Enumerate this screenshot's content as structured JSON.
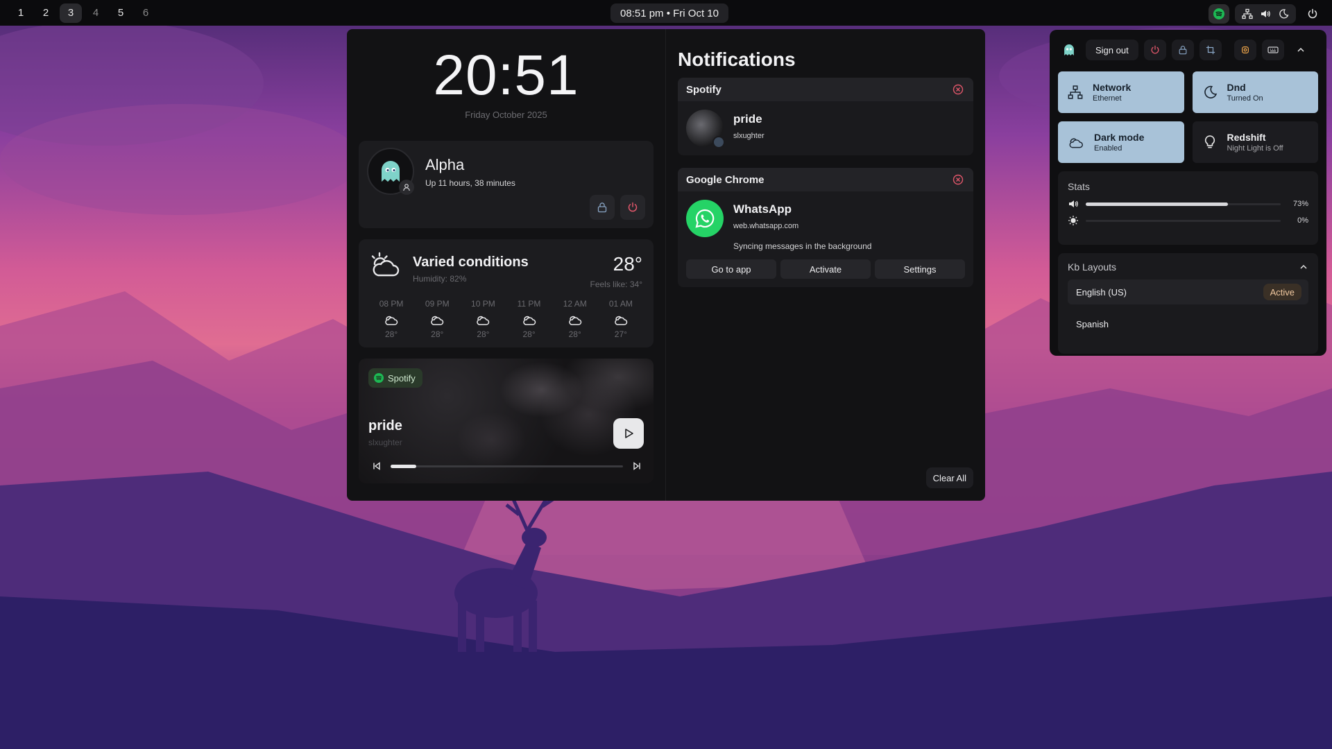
{
  "topbar": {
    "workspaces": [
      "1",
      "2",
      "3",
      "4",
      "5",
      "6"
    ],
    "active_workspace": "3",
    "datetime": "08:51 pm • Fri Oct 10"
  },
  "dashboard": {
    "time": "20:51",
    "date": "Friday October 2025",
    "user": {
      "name": "Alpha",
      "uptime": "Up 11 hours, 38 minutes"
    },
    "weather": {
      "condition": "Varied conditions",
      "humidity": "Humidity: 82%",
      "temperature": "28°",
      "feels_like": "Feels like: 34°",
      "hourly": [
        {
          "time": "08 PM",
          "temp": "28°"
        },
        {
          "time": "09 PM",
          "temp": "28°"
        },
        {
          "time": "10 PM",
          "temp": "28°"
        },
        {
          "time": "11 PM",
          "temp": "28°"
        },
        {
          "time": "12 AM",
          "temp": "28°"
        },
        {
          "time": "01 AM",
          "temp": "27°"
        }
      ]
    },
    "media": {
      "source": "Spotify",
      "title": "pride",
      "artist": "slxughter",
      "progress": 0.11
    }
  },
  "notifications": {
    "header": "Notifications",
    "items": [
      {
        "app": "Spotify",
        "title": "pride",
        "subtitle": "slxughter"
      },
      {
        "app": "Google Chrome",
        "title": "WhatsApp",
        "subtitle": "web.whatsapp.com",
        "message": "Syncing messages in the background",
        "actions": [
          "Go to app",
          "Activate",
          "Settings"
        ]
      }
    ],
    "clear_label": "Clear All"
  },
  "quick_settings": {
    "sign_out": "Sign out",
    "tiles": [
      {
        "label": "Network",
        "status": "Ethernet",
        "on": true,
        "icon": "network-icon"
      },
      {
        "label": "Dnd",
        "status": "Turned On",
        "on": true,
        "icon": "moon-icon"
      },
      {
        "label": "Dark mode",
        "status": "Enabled",
        "on": true,
        "icon": "cloud-moon-icon"
      },
      {
        "label": "Redshift",
        "status": "Night Light is Off",
        "on": false,
        "icon": "bulb-icon"
      }
    ],
    "stats": {
      "title": "Stats",
      "volume": {
        "label": "73%",
        "value": 0.73
      },
      "brightness": {
        "label": "0%",
        "value": 0.0
      }
    },
    "kb": {
      "title": "Kb Layouts",
      "layouts": [
        {
          "name": "English (US)",
          "badge": "Active"
        },
        {
          "name": "Spanish"
        }
      ]
    }
  },
  "colors": {
    "accent_tile": "#a8c2d8",
    "active_badge_bg": "#3a3026",
    "spotify_green": "#1db954",
    "whatsapp_green": "#25d366"
  }
}
